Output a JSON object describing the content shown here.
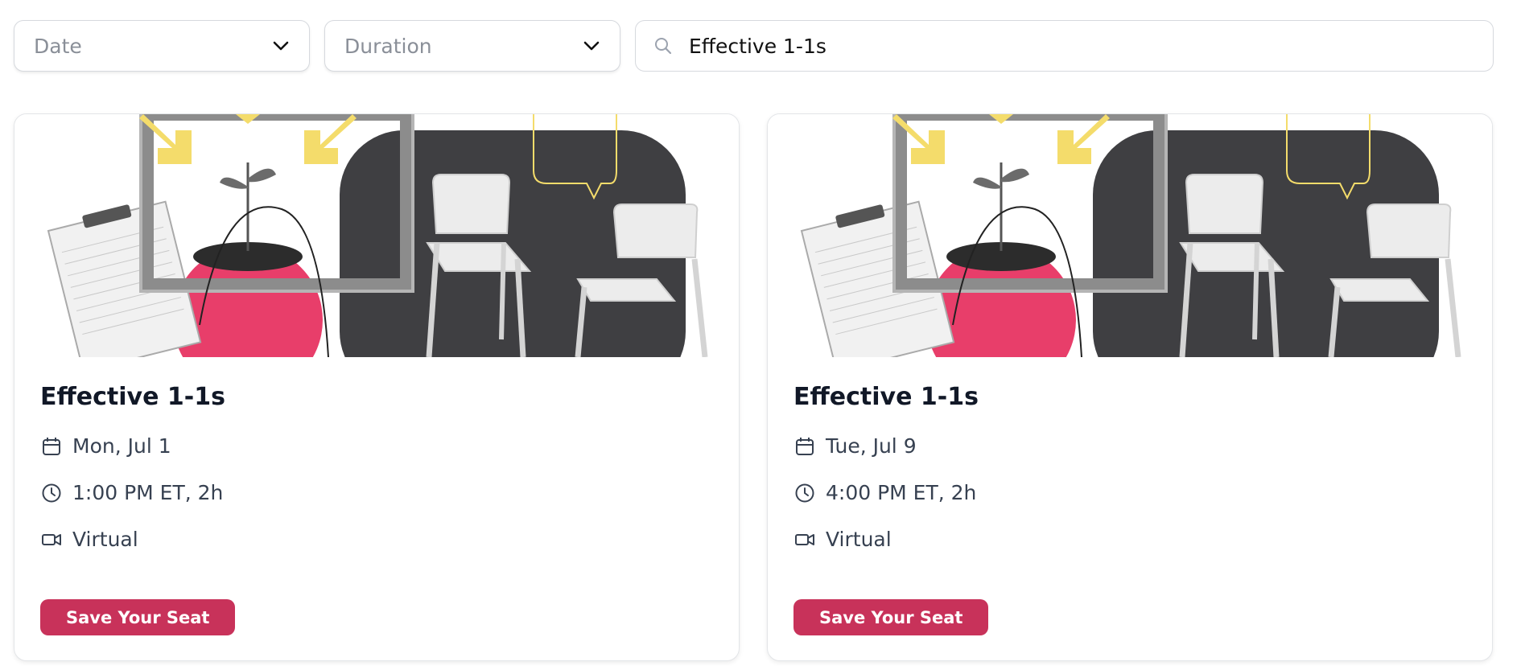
{
  "filters": {
    "date": {
      "placeholder": "Date"
    },
    "duration": {
      "placeholder": "Duration"
    },
    "search": {
      "value": "Effective 1-1s"
    }
  },
  "cards": [
    {
      "title": "Effective 1-1s",
      "date": "Mon, Jul 1",
      "time": "1:00 PM ET, 2h",
      "location": "Virtual",
      "cta": "Save Your Seat"
    },
    {
      "title": "Effective 1-1s",
      "date": "Tue, Jul 9",
      "time": "4:00 PM ET, 2h",
      "location": "Virtual",
      "cta": "Save Your Seat"
    }
  ],
  "icons": {
    "search": "search-icon",
    "chevron": "chevron-down-icon",
    "calendar": "calendar-icon",
    "clock": "clock-icon",
    "video": "video-camera-icon"
  },
  "colors": {
    "accent": "#c8325a",
    "art_pink": "#e83e6a",
    "art_dark": "#3f3f42",
    "art_yellow": "#f4dc6b"
  }
}
